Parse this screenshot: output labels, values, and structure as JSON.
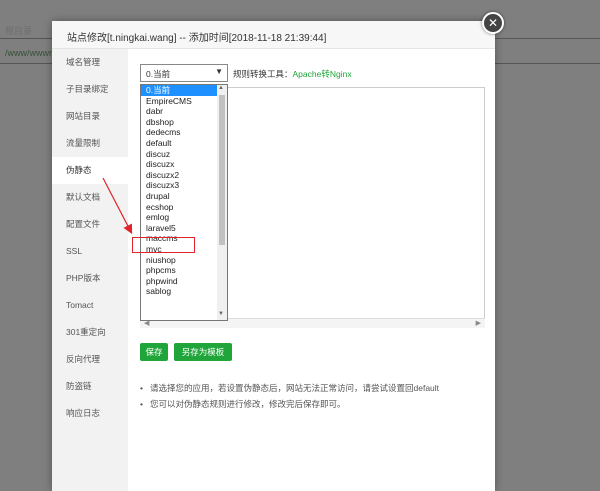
{
  "background": {
    "label_1": "根目录",
    "label_2": "/www/wwwro"
  },
  "modal": {
    "title": "站点修改[t.ningkai.wang] -- 添加时间[2018-11-18 21:39:44]",
    "close_glyph": "✕"
  },
  "sidebar": {
    "items": [
      {
        "label": "域名管理"
      },
      {
        "label": "子目录绑定"
      },
      {
        "label": "网站目录"
      },
      {
        "label": "流量限制"
      },
      {
        "label": "伪静态"
      },
      {
        "label": "默认文档"
      },
      {
        "label": "配置文件"
      },
      {
        "label": "SSL"
      },
      {
        "label": "PHP版本"
      },
      {
        "label": "Tomact"
      },
      {
        "label": "301重定向"
      },
      {
        "label": "反向代理"
      },
      {
        "label": "防盗链"
      },
      {
        "label": "响应日志"
      }
    ],
    "active_index": 4
  },
  "rewrite": {
    "selected_value": "0.当前",
    "arrow_glyph": "▼",
    "tool_label": "规则转换工具：",
    "tool_link": "Apache转Nginx",
    "options": [
      "0.当前",
      "EmpireCMS",
      "dabr",
      "dbshop",
      "dedecms",
      "default",
      "discuz",
      "discuzx",
      "discuzx2",
      "discuzx3",
      "drupal",
      "ecshop",
      "emlog",
      "laravel5",
      "maccms",
      "mvc",
      "niushop",
      "phpcms",
      "phpwind",
      "sablog"
    ],
    "highlighted_option": "laravel5"
  },
  "buttons": {
    "save": "保存",
    "save_as_template": "另存为模板"
  },
  "tips": [
    "请选择您的应用，若设置伪静态后，网站无法正常访问，请尝试设置回default",
    "您可以对伪静态规则进行修改，修改完后保存即可。"
  ],
  "colors": {
    "accent_green": "#20a53a",
    "highlight_red": "#e0242a",
    "selected_blue": "#1e90ff"
  }
}
